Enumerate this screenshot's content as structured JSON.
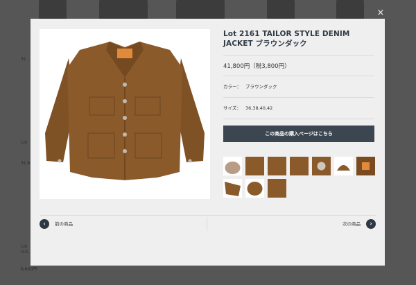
{
  "product": {
    "title": "Lot 2161 TAILOR STYLE DENIM JACKET ブラウンダック",
    "price": "41,800円（税3,800円）",
    "color_label": "カラー：",
    "color_value": "ブラウンダック",
    "size_label": "サイズ：",
    "size_value": "36,38,40,42"
  },
  "buttons": {
    "buy": "この商品の購入ページはこちら",
    "prev": "前の商品",
    "next": "次の商品",
    "close": "×"
  },
  "icons": {
    "prev_arrow": "chevron-left-icon",
    "next_arrow": "chevron-right-icon",
    "close": "close-icon"
  },
  "colors": {
    "accent": "#3c4650",
    "nav_circle": "#2e3945",
    "jacket": "#8b5a2b"
  },
  "background_text": [
    "31 ...",
    "Lot",
    "31.8",
    "Lot",
    "Lot",
    "U.S.",
    "6,600円"
  ]
}
